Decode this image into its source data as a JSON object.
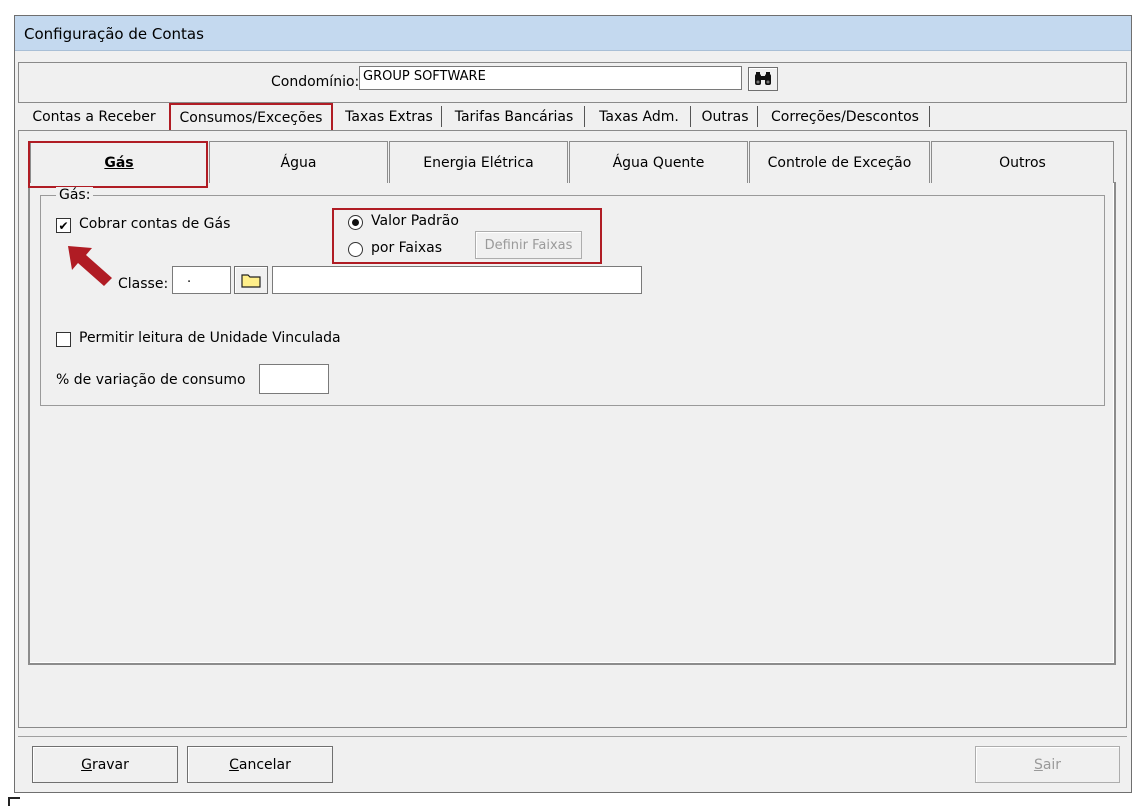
{
  "window": {
    "title": "Configuração de Contas"
  },
  "condominio": {
    "label": "Condomínio:",
    "value": "GROUP SOFTWARE",
    "search_icon": "binoculars-icon"
  },
  "main_tabs": [
    {
      "label": "Contas a Receber"
    },
    {
      "label": "Consumos/Exceções",
      "selected": true
    },
    {
      "label": "Taxas Extras"
    },
    {
      "label": "Tarifas Bancárias"
    },
    {
      "label": "Taxas Adm."
    },
    {
      "label": "Outras"
    },
    {
      "label": "Correções/Descontos"
    }
  ],
  "sub_tabs": [
    {
      "label": "Gás",
      "selected": true
    },
    {
      "label": "Água"
    },
    {
      "label": "Energia Elétrica"
    },
    {
      "label": "Água Quente"
    },
    {
      "label": "Controle de Exceção"
    },
    {
      "label": "Outros"
    }
  ],
  "gas": {
    "group_label": "Gás:",
    "cobrar_label": "Cobrar contas de Gás",
    "cobrar_checked": true,
    "radio_valor_padrao": "Valor Padrão",
    "radio_por_faixas": "por Faixas",
    "selected_radio": "Valor Padrão",
    "definir_faixas": "Definir Faixas",
    "classe_label": "Classe:",
    "classe_code": ".",
    "classe_folder_icon": "folder-icon",
    "classe_desc": "",
    "permitir_label": "Permitir leitura de Unidade Vinculada",
    "permitir_checked": false,
    "variacao_label": "% de variação de consumo",
    "variacao_value": ""
  },
  "buttons": {
    "gravar": "Gravar",
    "cancelar": "Cancelar",
    "sair": "Sair"
  },
  "colors": {
    "annotation_red": "#b01c24",
    "titlebar": "#c4d9ef"
  }
}
